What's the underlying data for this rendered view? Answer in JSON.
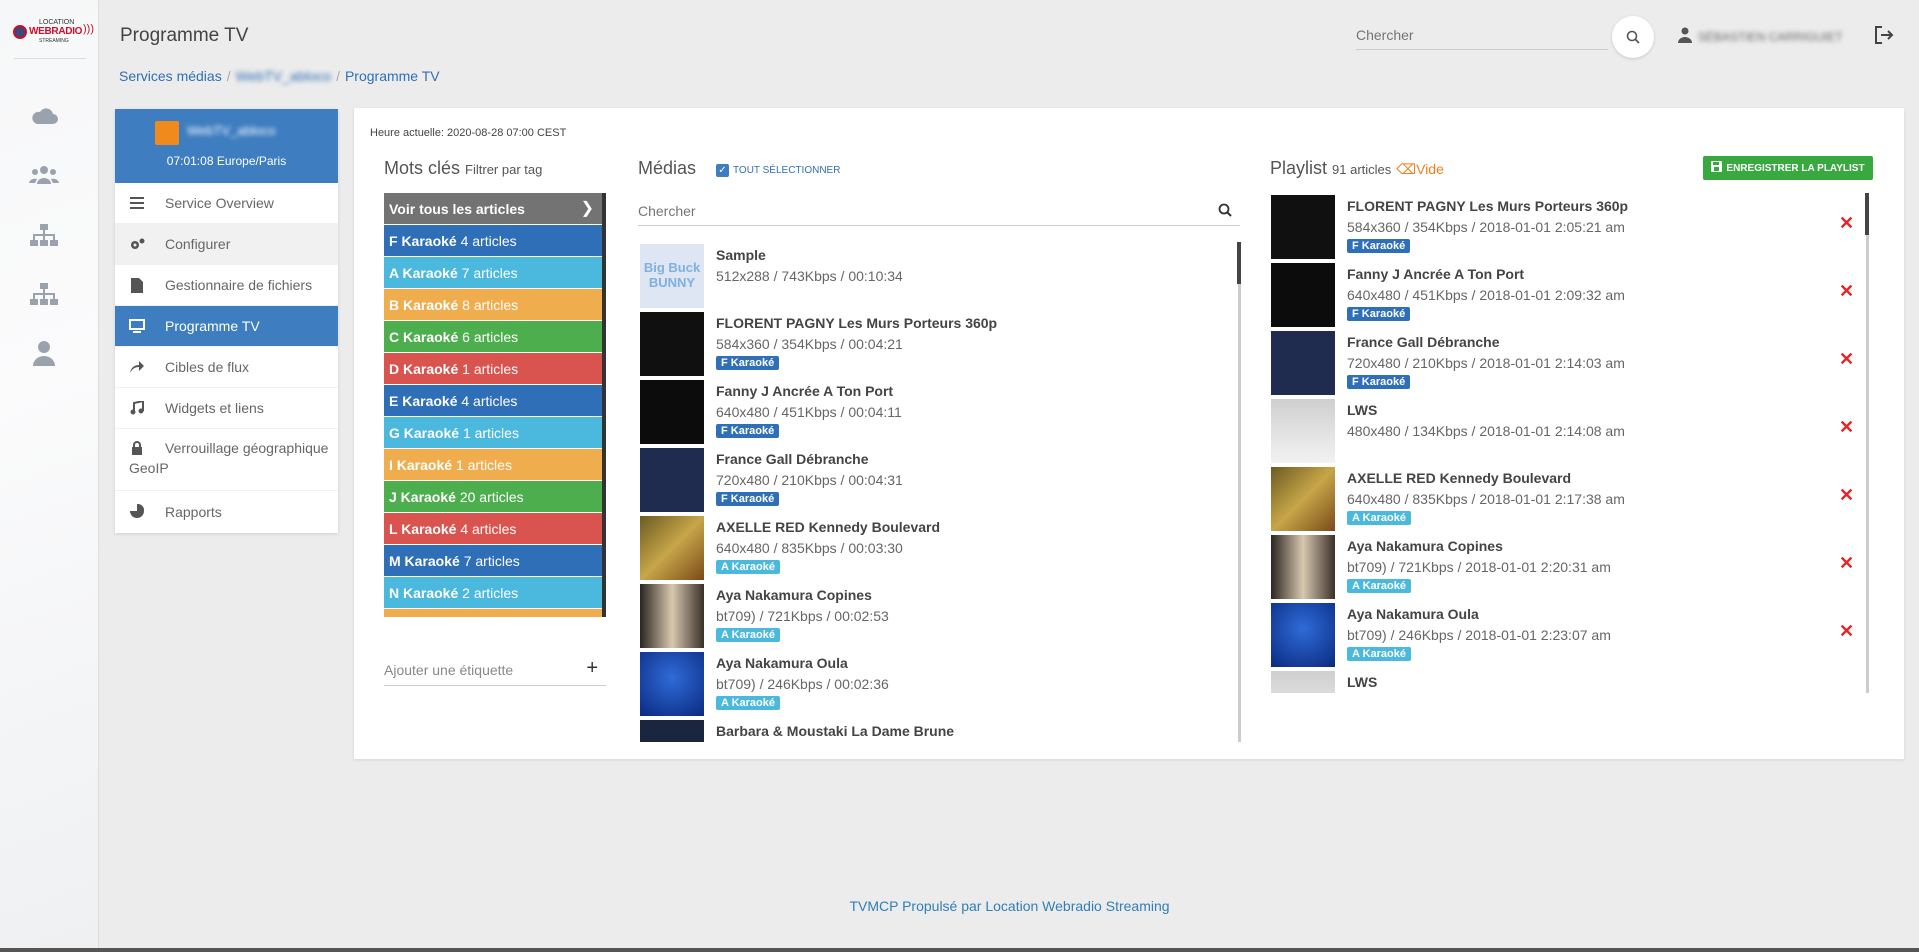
{
  "brand": {
    "line1": "LOCATION",
    "line2": "WEBRADIO",
    "line3": "STREAMING"
  },
  "header": {
    "title": "Programme TV",
    "search_placeholder": "Chercher",
    "user_name": "SÉBASTIEN CARRIGUIET"
  },
  "breadcrumb": [
    "Services médias",
    "WebTV_abloco",
    "Programme TV"
  ],
  "service": {
    "name": "WebTV_abloco",
    "time": "07:01:08 Europe/Paris"
  },
  "menu": [
    {
      "label": "Service Overview",
      "icon": "list-icon"
    },
    {
      "label": "Configurer",
      "icon": "cogs-icon"
    },
    {
      "label": "Gestionnaire de fichiers",
      "icon": "file-icon"
    },
    {
      "label": "Programme TV",
      "icon": "monitor-icon"
    },
    {
      "label": "Cibles de flux",
      "icon": "share-icon"
    },
    {
      "label": "Widgets et liens",
      "icon": "music-icon"
    },
    {
      "label": "Verrouillage géographique GeoIP",
      "icon": "lock-icon"
    },
    {
      "label": "Rapports",
      "icon": "pie-chart-icon"
    }
  ],
  "main": {
    "clock": "Heure actuelle: 2020-08-28 07:00 CEST",
    "keywords": {
      "title": "Mots clés",
      "subtitle": "Filtrer par tag",
      "all_label": "Voir tous les articles",
      "add_placeholder": "Ajouter une étiquette"
    },
    "media_title": "Médias",
    "select_all": "TOUT SÉLECTIONNER",
    "media_search_placeholder": "Chercher",
    "playlist_title": "Playlist",
    "playlist_count": "91 articles",
    "playlist_empty": "Vide",
    "save_label": "ENREGISTRER LA PLAYLIST"
  },
  "tags": [
    {
      "name": "F Karaoké",
      "count": "4 articles",
      "color": "#2f6fb8"
    },
    {
      "name": "A Karaoké",
      "count": "7 articles",
      "color": "#4bb8dd"
    },
    {
      "name": "B Karaoké",
      "count": "8 articles",
      "color": "#f0ad4e"
    },
    {
      "name": "C Karaoké",
      "count": "6 articles",
      "color": "#4cae4c"
    },
    {
      "name": "D Karaoké",
      "count": "1 articles",
      "color": "#d9534f"
    },
    {
      "name": "E Karaoké",
      "count": "4 articles",
      "color": "#2f6fb8"
    },
    {
      "name": "G Karaoké",
      "count": "1 articles",
      "color": "#4bb8dd"
    },
    {
      "name": "I Karaoké",
      "count": "1 articles",
      "color": "#f0ad4e"
    },
    {
      "name": "J Karaoké",
      "count": "20 articles",
      "color": "#4cae4c"
    },
    {
      "name": "L Karaoké",
      "count": "4 articles",
      "color": "#d9534f"
    },
    {
      "name": "M Karaoké",
      "count": "7 articles",
      "color": "#2f6fb8"
    },
    {
      "name": "N Karaoké",
      "count": "2 articles",
      "color": "#4bb8dd"
    },
    {
      "name": "",
      "count": "",
      "color": "#f0ad4e"
    }
  ],
  "media": [
    {
      "title": "Sample",
      "meta": "512x288 / 743Kbps / 00:10:34",
      "badge": "",
      "badge_color": "",
      "thumb": "t-sample",
      "thumb_text": "Big Buck BUNNY"
    },
    {
      "title": "FLORENT PAGNY Les Murs Porteurs 360p",
      "meta": "584x360 / 354Kbps / 00:04:21",
      "badge": "F Karaoké",
      "badge_color": "#2f6fb8",
      "thumb": "t-dark",
      "thumb_text": ""
    },
    {
      "title": "Fanny J Ancrée A Ton Port",
      "meta": "640x480 / 451Kbps / 00:04:11",
      "badge": "F Karaoké",
      "badge_color": "#2f6fb8",
      "thumb": "t-kara",
      "thumb_text": ""
    },
    {
      "title": "France Gall Débranche",
      "meta": "720x480 / 210Kbps / 00:04:31",
      "badge": "F Karaoké",
      "badge_color": "#2f6fb8",
      "thumb": "t-navy",
      "thumb_text": ""
    },
    {
      "title": "AXELLE RED Kennedy Boulevard",
      "meta": "640x480 / 835Kbps / 00:03:30",
      "badge": "A Karaoké",
      "badge_color": "#4bb8dd",
      "thumb": "t-axelle",
      "thumb_text": ""
    },
    {
      "title": "Aya Nakamura Copines",
      "meta": "bt709) / 721Kbps / 00:02:53",
      "badge": "A Karaoké",
      "badge_color": "#4bb8dd",
      "thumb": "t-aya",
      "thumb_text": ""
    },
    {
      "title": "Aya Nakamura Oula",
      "meta": "bt709) / 246Kbps / 00:02:36",
      "badge": "A Karaoké",
      "badge_color": "#4bb8dd",
      "thumb": "t-blue",
      "thumb_text": ""
    },
    {
      "title": "Barbara & Moustaki La Dame Brune",
      "meta": "",
      "badge": "",
      "badge_color": "",
      "thumb": "t-barbara",
      "thumb_text": ""
    }
  ],
  "playlist": [
    {
      "title": "FLORENT PAGNY Les Murs Porteurs 360p",
      "meta": "584x360 / 354Kbps / 2018-01-01 2:05:21 am",
      "badge": "F Karaoké",
      "badge_color": "#2f6fb8",
      "thumb": "t-dark"
    },
    {
      "title": "Fanny J Ancrée A Ton Port",
      "meta": "640x480 / 451Kbps / 2018-01-01 2:09:32 am",
      "badge": "F Karaoké",
      "badge_color": "#2f6fb8",
      "thumb": "t-kara"
    },
    {
      "title": "France Gall Débranche",
      "meta": "720x480 / 210Kbps / 2018-01-01 2:14:03 am",
      "badge": "F Karaoké",
      "badge_color": "#2f6fb8",
      "thumb": "t-navy"
    },
    {
      "title": "LWS",
      "meta": "480x480 / 134Kbps / 2018-01-01 2:14:08 am",
      "badge": "",
      "badge_color": "",
      "thumb": "t-lws"
    },
    {
      "title": "AXELLE RED Kennedy Boulevard",
      "meta": "640x480 / 835Kbps / 2018-01-01 2:17:38 am",
      "badge": "A Karaoké",
      "badge_color": "#4bb8dd",
      "thumb": "t-axelle"
    },
    {
      "title": "Aya Nakamura Copines",
      "meta": "bt709) / 721Kbps / 2018-01-01 2:20:31 am",
      "badge": "A Karaoké",
      "badge_color": "#4bb8dd",
      "thumb": "t-aya"
    },
    {
      "title": "Aya Nakamura Oula",
      "meta": "bt709) / 246Kbps / 2018-01-01 2:23:07 am",
      "badge": "A Karaoké",
      "badge_color": "#4bb8dd",
      "thumb": "t-blue"
    },
    {
      "title": "LWS",
      "meta": "",
      "badge": "",
      "badge_color": "",
      "thumb": "t-lws"
    }
  ],
  "footer": "TVMCP Propulsé par Location Webradio Streaming"
}
